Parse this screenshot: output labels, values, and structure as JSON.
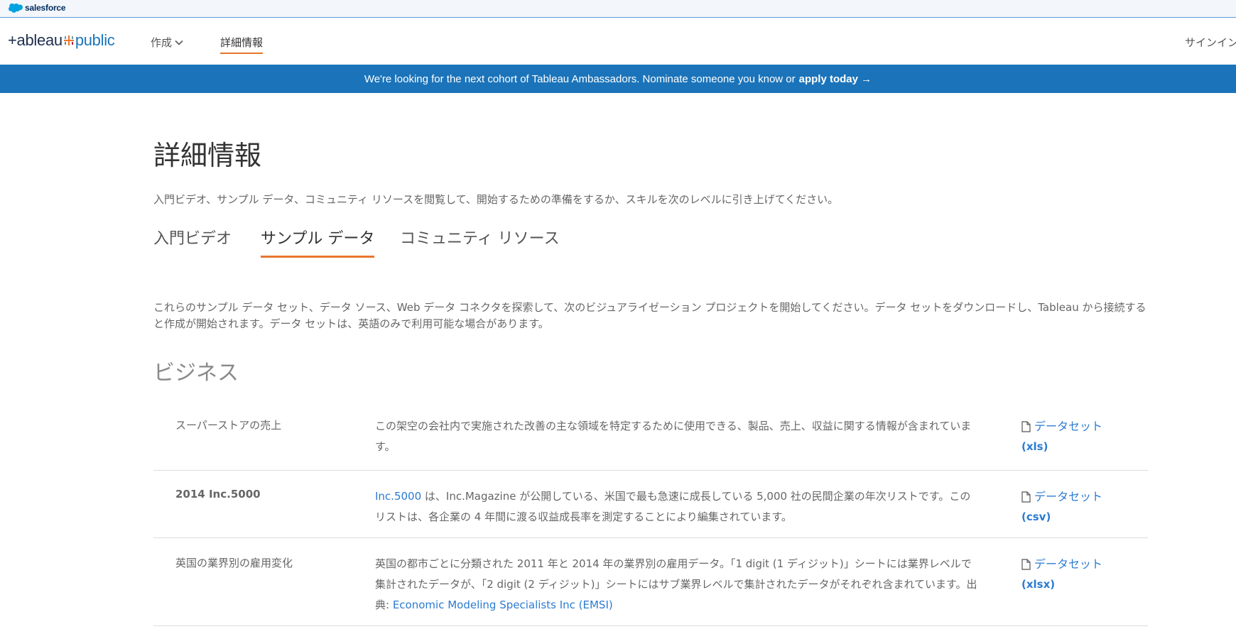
{
  "salesforce_bar": {
    "brand": "salesforce"
  },
  "nav": {
    "logo_text": {
      "prefix": "+ableau",
      "suffix": "public"
    },
    "create": "作成",
    "learn": "詳細情報",
    "signin": "サインイン"
  },
  "banner": {
    "text": "We're looking for the next cohort of Tableau Ambassadors. Nominate someone you know or",
    "cta": "apply today →"
  },
  "page": {
    "title": "詳細情報",
    "intro": "入門ビデオ、サンプル データ、コミュニティ リソースを閲覧して、開始するための準備をするか、スキルを次のレベルに引き上げてください。",
    "tabs": [
      "入門ビデオ",
      "サンプル データ",
      "コミュニティ リソース"
    ],
    "active_tab": "サンプル データ",
    "description": "これらのサンプル データ セット、データ ソース、Web データ コネクタを探索して、次のビジュアライゼーション プロジェクトを開始してください。データ セットをダウンロードし、Tableau から接続すると作成が開始されます。データ セットは、英語のみで利用可能な場合があります。",
    "section_title": "ビジネス"
  },
  "datasets": [
    {
      "name": "スーパーストアの売上",
      "description": "この架空の会社内で実施された改善の主な領域を特定するために使用できる、製品、売上、収益に関する情報が含まれています。",
      "link_label": "データセット",
      "format": "(xls)"
    },
    {
      "name": "2014 Inc.5000",
      "link_text": "Inc.5000",
      "description": " は、Inc.Magazine が公開している、米国で最も急速に成長している 5,000 社の民間企業の年次リストです。このリストは、各企業の 4 年間に渡る収益成長率を測定することにより編集されています。",
      "link_label": "データセット",
      "format": "(csv)"
    },
    {
      "name": "英国の業界別の雇用変化",
      "description": "英国の都市ごとに分類された 2011 年と 2014 年の業界別の雇用データ。「1 digit (1 ディジット)」シートには業界レベルで集計されたデータが、「2 digit (2 ディジット)」シートにはサブ業界レベルで集計されたデータがそれぞれ含まれています。出典: ",
      "source_link": "Economic Modeling Specialists Inc (EMSI)",
      "link_label": "データセット",
      "format": "(xlsx)"
    }
  ],
  "colors": {
    "accent": "#e8762d",
    "banner": "#1b74ba",
    "link": "#2b7bd2",
    "salesforce": "#00a1e0"
  }
}
